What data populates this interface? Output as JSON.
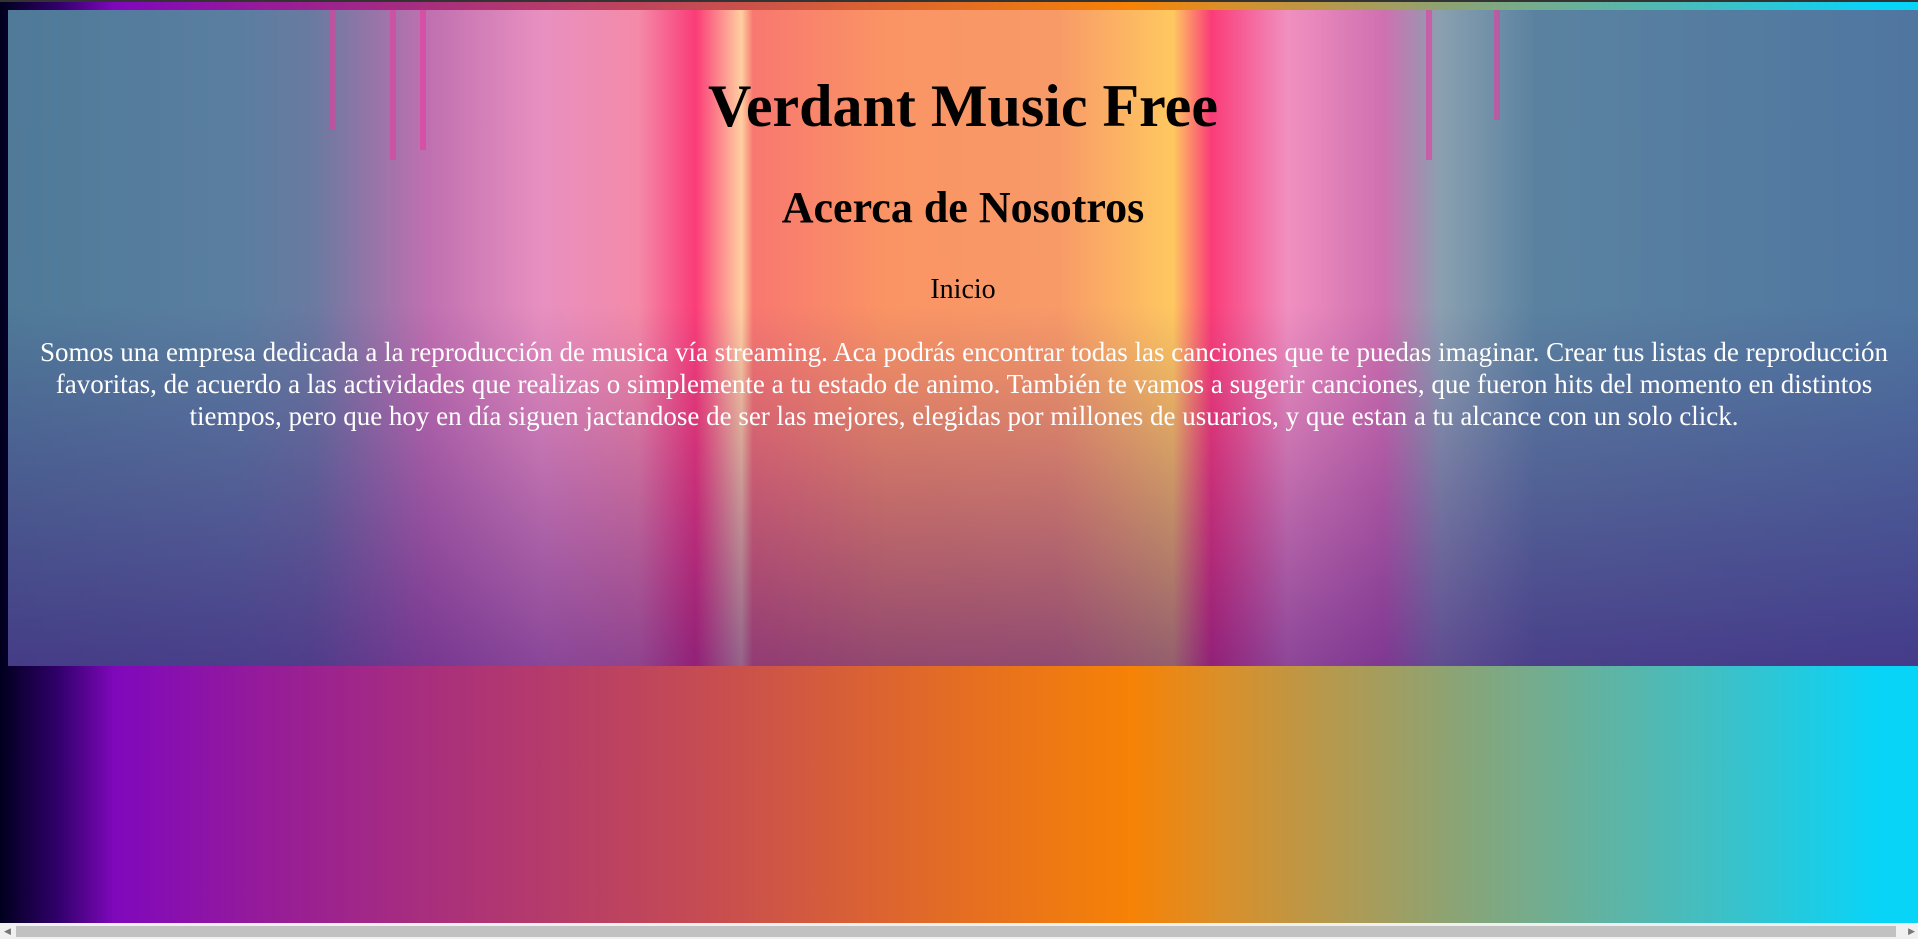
{
  "header": {
    "title": "Verdant Music Free",
    "subtitle": "Acerca de Nosotros"
  },
  "nav": {
    "items": [
      {
        "label": "Inicio"
      }
    ]
  },
  "about": {
    "text": "Somos una empresa dedicada a la reproducción de musica vía streaming. Aca podrás encontrar todas las canciones que te puedas imaginar. Crear tus listas de reproducción favoritas, de acuerdo a las actividades que realizas o simplemente a tu estado de animo. También te vamos a sugerir canciones, que fueron hits del momento en distintos tiempos, pero que hoy en día siguen jactandose de ser las mejores, elegidas por millones de usuarios, y que estan a tu alcance con un solo click."
  },
  "colors": {
    "gradient_start": "#00001e",
    "gradient_purple": "#8008bc",
    "gradient_orange": "#f68206",
    "gradient_end": "#08d4f8",
    "about_text": "#ffffff"
  },
  "icons": [
    "scroll-left-arrow-icon",
    "scroll-right-arrow-icon"
  ]
}
